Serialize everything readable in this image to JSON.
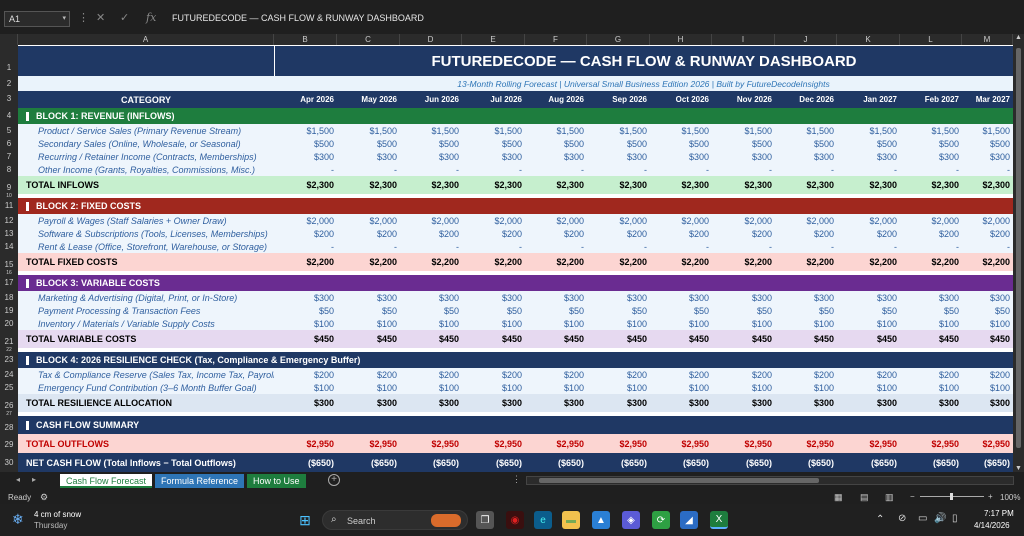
{
  "formula_bar": {
    "cell_ref": "A1",
    "content": "FUTUREDECODE  —  CASH FLOW & RUNWAY DASHBOARD"
  },
  "columns": [
    "A",
    "B",
    "C",
    "D",
    "E",
    "F",
    "G",
    "H",
    "I",
    "J",
    "K",
    "L",
    "M"
  ],
  "row_numbers": [
    "1",
    "2",
    "3",
    "4",
    "5",
    "6",
    "7",
    "8",
    "9",
    "10",
    "11",
    "12",
    "13",
    "14",
    "15",
    "16",
    "17",
    "18",
    "19",
    "20",
    "21",
    "22",
    "23",
    "24",
    "25",
    "26",
    "27",
    "28",
    "29",
    "30"
  ],
  "sheet": {
    "title": "FUTUREDECODE  —  CASH FLOW & RUNWAY DASHBOARD",
    "subtitle": "13-Month Rolling Forecast   |   Universal Small Business Edition 2026   |   Built by FutureDecodeInsights",
    "category_header": "CATEGORY",
    "months": [
      "Apr 2026",
      "May 2026",
      "Jun 2026",
      "Jul 2026",
      "Aug 2026",
      "Sep 2026",
      "Oct 2026",
      "Nov 2026",
      "Dec 2026",
      "Jan 2027",
      "Feb 2027",
      "Mar 2027"
    ],
    "block1": {
      "title": "BLOCK 1: REVENUE (INFLOWS)",
      "rows": [
        {
          "label": "Product / Service Sales  (Primary Revenue Stream)",
          "value": "$1,500"
        },
        {
          "label": "Secondary Sales  (Online, Wholesale, or Seasonal)",
          "value": "$500"
        },
        {
          "label": "Recurring / Retainer Income  (Contracts, Memberships)",
          "value": "$300"
        },
        {
          "label": "Other Income  (Grants, Royalties, Commissions, Misc.)",
          "value": "-"
        }
      ],
      "total_label": "TOTAL INFLOWS",
      "total_value": "$2,300"
    },
    "block2": {
      "title": "BLOCK 2: FIXED COSTS",
      "rows": [
        {
          "label": "Payroll & Wages  (Staff Salaries + Owner Draw)",
          "value": "$2,000"
        },
        {
          "label": "Software & Subscriptions  (Tools, Licenses, Memberships)",
          "value": "$200"
        },
        {
          "label": "Rent & Lease  (Office, Storefront, Warehouse, or Storage)",
          "value": "-"
        }
      ],
      "total_label": "TOTAL FIXED COSTS",
      "total_value": "$2,200"
    },
    "block3": {
      "title": "BLOCK 3: VARIABLE COSTS",
      "rows": [
        {
          "label": "Marketing & Advertising  (Digital, Print, or In-Store)",
          "value": "$300"
        },
        {
          "label": "Payment Processing & Transaction Fees",
          "value": "$50"
        },
        {
          "label": "Inventory / Materials / Variable Supply Costs",
          "value": "$100"
        }
      ],
      "total_label": "TOTAL VARIABLE COSTS",
      "total_value": "$450"
    },
    "block4": {
      "title": "BLOCK 4: 2026 RESILIENCE CHECK  (Tax, Compliance & Emergency Buffer)",
      "rows": [
        {
          "label": "Tax & Compliance Reserve  (Sales Tax, Income Tax, Payroll)",
          "value": "$200"
        },
        {
          "label": "Emergency Fund Contribution  (3–6 Month Buffer Goal)",
          "value": "$100"
        }
      ],
      "total_label": "TOTAL RESILIENCE ALLOCATION",
      "total_value": "$300"
    },
    "summary": {
      "title": "CASH FLOW SUMMARY",
      "outflows_label": "TOTAL OUTFLOWS",
      "outflows_value": "$2,950",
      "net_label": "NET CASH FLOW  (Total Inflows − Total Outflows)",
      "net_value": "($650)"
    }
  },
  "tabs": [
    "Cash Flow Forecast",
    "Formula Reference",
    "How to Use"
  ],
  "status": {
    "ready": "Ready",
    "zoom": "100%"
  },
  "taskbar": {
    "weather": "4 cm of snow",
    "weather_sub": "Thursday",
    "search": "Search",
    "time": "7:17 PM",
    "date": "4/14/2026"
  },
  "colors": {
    "title_bg": "#1f3864",
    "block1": "#1e7d3e",
    "block2": "#a0281e",
    "block3": "#6a2c91",
    "block4": "#1f3864"
  }
}
